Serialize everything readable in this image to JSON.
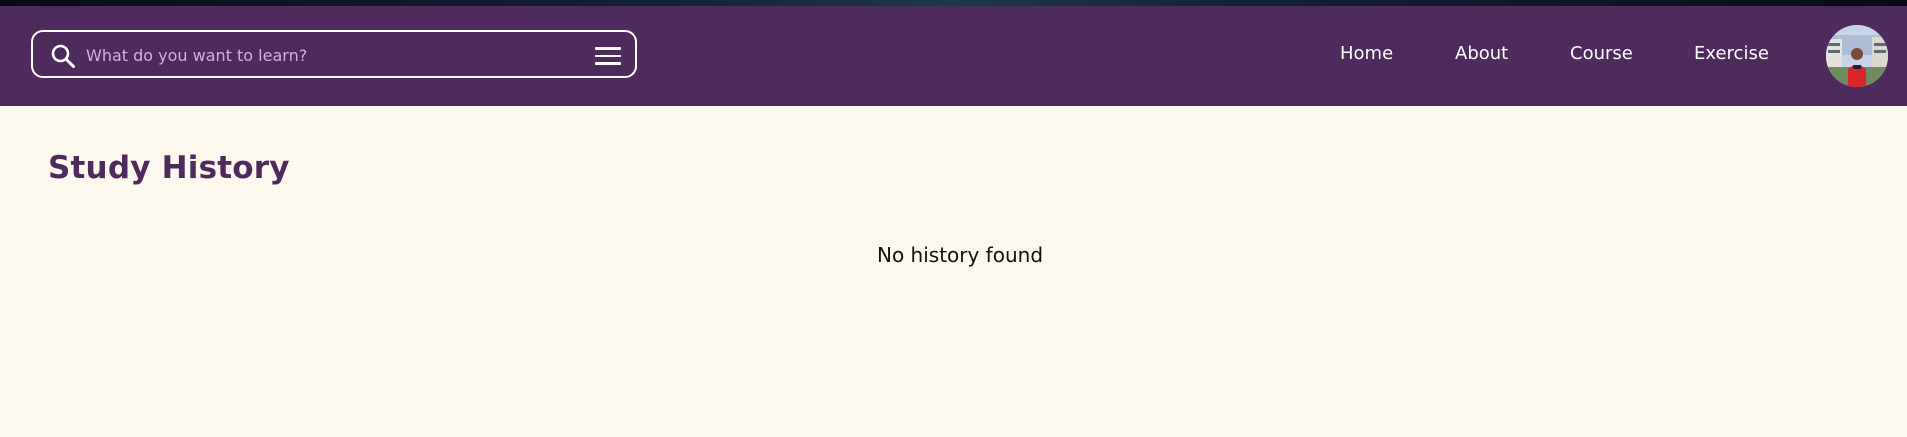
{
  "header": {
    "search": {
      "placeholder": "What do you want to learn?",
      "value": "",
      "icon": "search-icon",
      "menu_icon": "hamburger-menu-icon"
    },
    "nav": [
      {
        "label": "Home"
      },
      {
        "label": "About"
      },
      {
        "label": "Course"
      },
      {
        "label": "Exercise"
      }
    ],
    "avatar": "user-avatar"
  },
  "main": {
    "title": "Study History",
    "empty_message": "No history found"
  },
  "colors": {
    "navbar": "#4e2a5d",
    "page_background": "#fdf8ed",
    "title": "#4e2a5d",
    "nav_text": "#ffffff"
  }
}
